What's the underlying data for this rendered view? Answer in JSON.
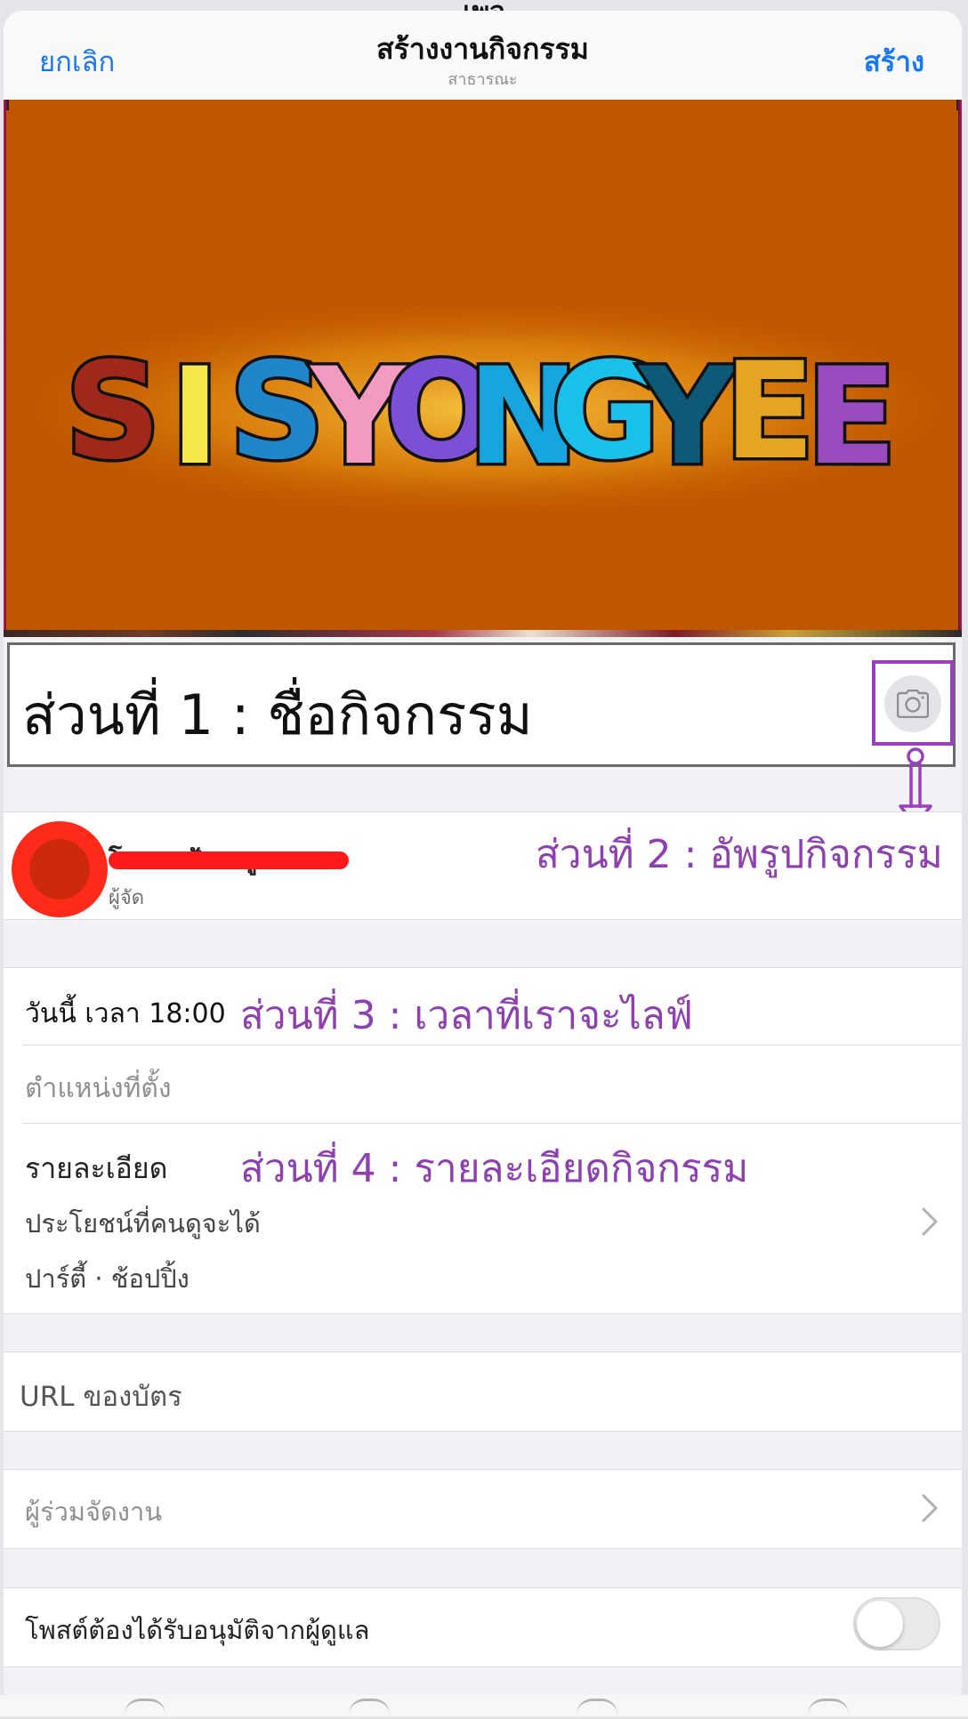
{
  "background": {
    "title": "เพจ"
  },
  "navbar": {
    "cancel_label": "ยกเลิก",
    "title": "สร้างงานกิจกรรม",
    "subtitle": "สาธารณะ",
    "create_label": "สร้าง"
  },
  "cover": {
    "logo_text": "SISYONGYEE",
    "logo_colors": [
      "#a0281a",
      "#f6e84a",
      "#1f86c9",
      "#f39ac0",
      "#7b4fd6",
      "#17a5e0",
      "#18c0ea",
      "#0d5a78",
      "#e5a523",
      "#9a4bbf",
      "#2aa6d8"
    ]
  },
  "title_section": {
    "text": "ส่วนที่ 1 : ชื่อกิจกรรม",
    "camera_icon": "camera-icon"
  },
  "organizer": {
    "name": "โดเดสเป้วเตดูล",
    "role": "ผู้จัด"
  },
  "annotations": {
    "part2": "ส่วนที่ 2 : อัพรูปกิจกรรม",
    "part3": "ส่วนที่ 3 : เวลาที่เราจะไลฟ์",
    "part4": "ส่วนที่ 4 : รายละเอียดกิจกรรม",
    "color": "#8e3fb0"
  },
  "event": {
    "time": "วันนี้ เวลา 18:00",
    "location_placeholder": "ตำแหน่งที่ตั้ง",
    "details_label": "รายละเอียด",
    "details_line1": "ประโยชน์ที่คนดูจะได้",
    "details_line2": "ปาร์ตี้ · ช้อปปิ้ง"
  },
  "ticket_url": {
    "label": "URL ของบัตร"
  },
  "cohosts": {
    "label": "ผู้ร่วมจัดงาน"
  },
  "approval": {
    "label": "โพสต์ต้องได้รับอนุมัติจากผู้ดูแล",
    "enabled": false
  },
  "colors": {
    "accent": "#1877f2",
    "cover_bg": "#bf5600",
    "redaction": "#ff1a1a"
  }
}
